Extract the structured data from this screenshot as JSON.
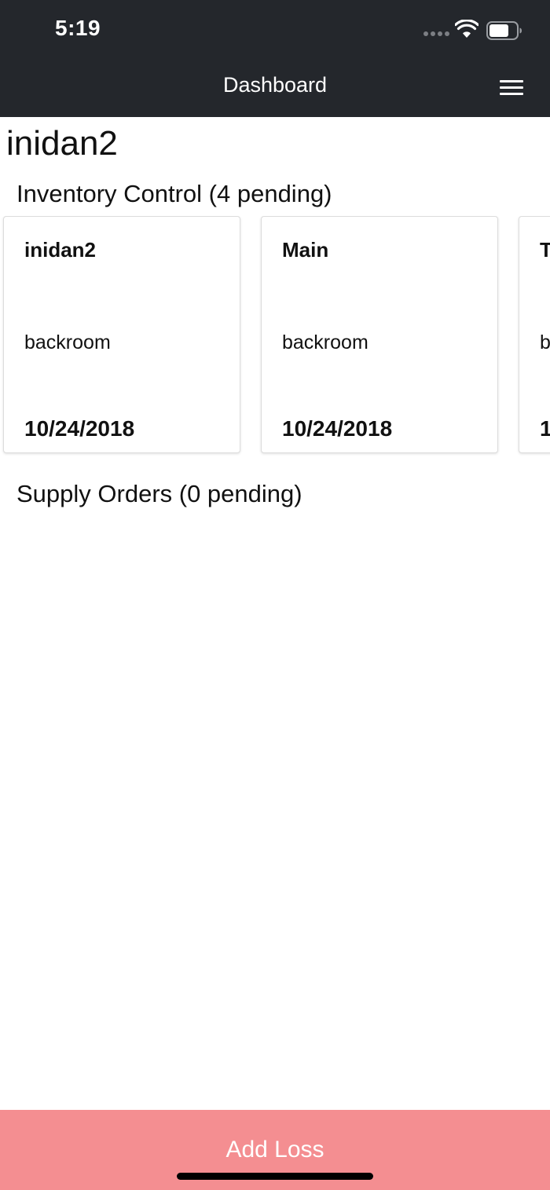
{
  "status_bar": {
    "time": "5:19"
  },
  "header": {
    "title": "Dashboard",
    "menu_icon": "hamburger-menu-icon"
  },
  "user": {
    "name": "inidan2"
  },
  "inventory_control": {
    "title": "Inventory Control (4 pending)",
    "cards": [
      {
        "title": "inidan2",
        "location": "backroom",
        "date": "10/24/2018"
      },
      {
        "title": "Main",
        "location": "backroom",
        "date": "10/24/2018"
      },
      {
        "title": "T",
        "location": "b",
        "date": "1"
      }
    ]
  },
  "supply_orders": {
    "title": "Supply Orders (0 pending)"
  },
  "footer": {
    "button_label": "Add Loss"
  },
  "colors": {
    "header_bg": "#24272c",
    "footer_bg": "#f48e91",
    "card_border": "#dcdcdc"
  }
}
